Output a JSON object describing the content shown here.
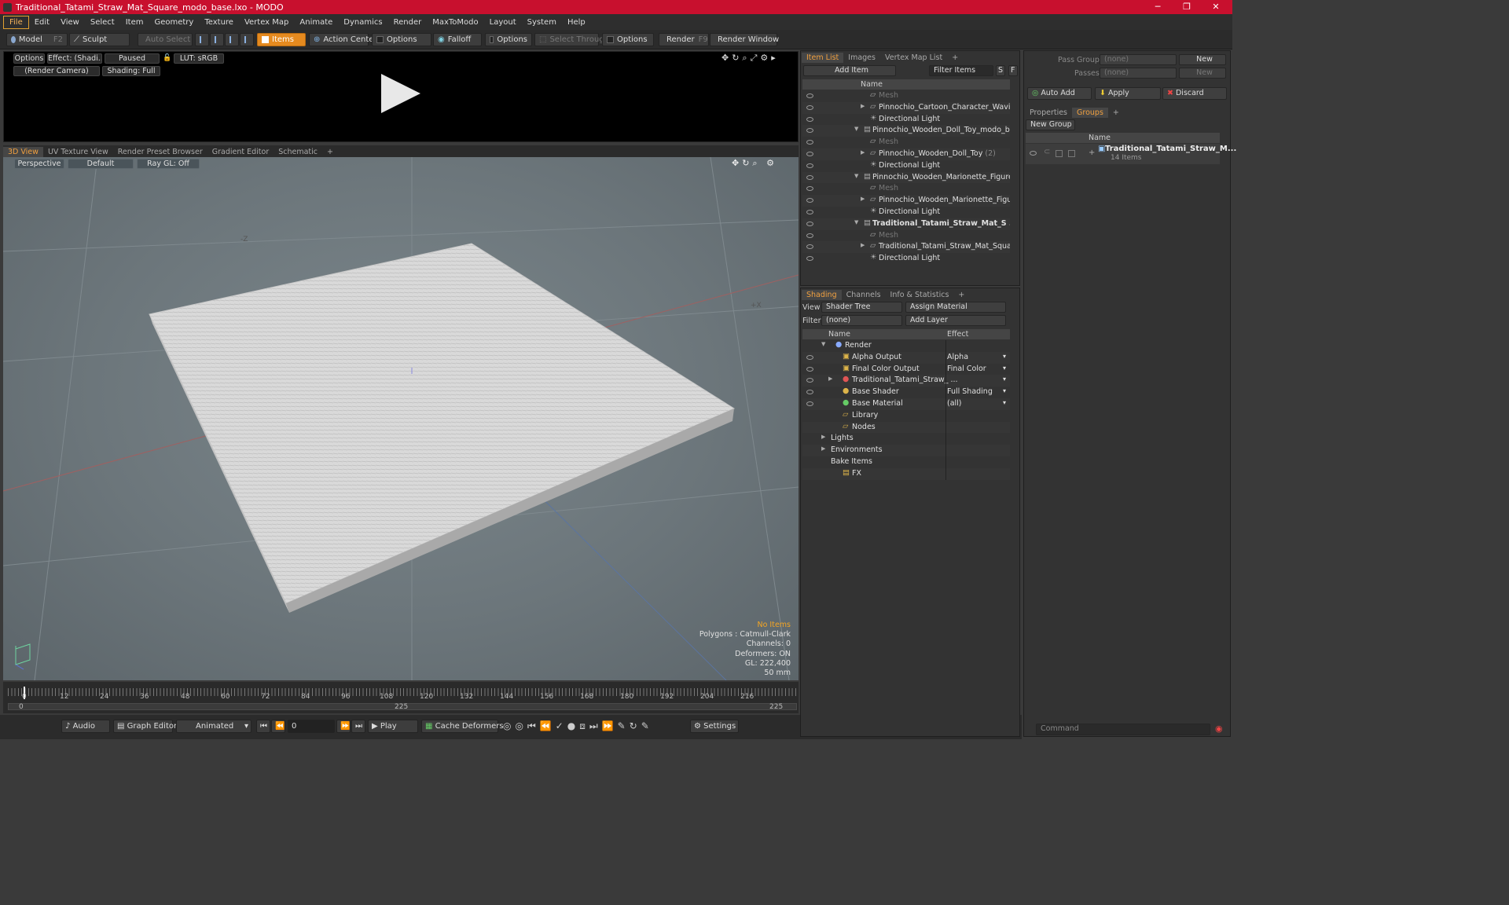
{
  "window": {
    "title": "Traditional_Tatami_Straw_Mat_Square_modo_base.lxo - MODO",
    "minimize": "─",
    "maximize": "❐",
    "close": "✕"
  },
  "menu": [
    "File",
    "Edit",
    "View",
    "Select",
    "Item",
    "Geometry",
    "Texture",
    "Vertex Map",
    "Animate",
    "Dynamics",
    "Render",
    "MaxToModo",
    "Layout",
    "System",
    "Help"
  ],
  "toolbar": {
    "model": "Model",
    "model_key": "F2",
    "sculpt": "Sculpt",
    "auto_select": "Auto Select",
    "items": "Items",
    "action_center": "Action Center",
    "options1": "Options",
    "falloff": "Falloff",
    "options2": "Options",
    "select_through": "Select Through",
    "options3": "Options",
    "render": "Render",
    "render_key": "F9",
    "render_window": "Render Window"
  },
  "render_view": {
    "options": "Options",
    "effect": "Effect: (Shadi...",
    "status": "Paused",
    "lut": "LUT: sRGB",
    "camera": "(Render Camera)",
    "shading": "Shading: Full"
  },
  "view_tabs": [
    "3D View",
    "UV Texture View",
    "Render Preset Browser",
    "Gradient Editor",
    "Schematic",
    "+"
  ],
  "viewport": {
    "perspective": "Perspective",
    "default": "Default",
    "raygl": "Ray GL: Off",
    "axis_z": "-Z",
    "axis_x": "+X",
    "info": {
      "no_items": "No Items",
      "polygons": "Polygons : Catmull-Clark",
      "channels": "Channels: 0",
      "deformers": "Deformers: ON",
      "gl": "GL: 222,400",
      "unit": "50 mm"
    }
  },
  "timeline": {
    "ticks": [
      "0",
      "12",
      "24",
      "36",
      "48",
      "60",
      "72",
      "84",
      "96",
      "108",
      "120",
      "132",
      "144",
      "156",
      "168",
      "180",
      "192",
      "204",
      "216"
    ],
    "start": "0",
    "mid": "225",
    "end": "225"
  },
  "bottombar": {
    "audio": "Audio",
    "graph_editor": "Graph Editor",
    "animated": "Animated",
    "frame": "0",
    "play": "Play",
    "cache": "Cache Deformers",
    "settings": "Settings"
  },
  "item_list": {
    "tabs": [
      "Item List",
      "Images",
      "Vertex Map List",
      "+"
    ],
    "add_item": "Add Item",
    "filter": "Filter Items",
    "s": "S",
    "f": "F",
    "col_name": "Name",
    "rows": [
      {
        "label": "Mesh",
        "dim": true,
        "indent": 2
      },
      {
        "label": "Pinnochio_Cartoon_Character_Wavin ...",
        "indent": 2,
        "arrow": "▶"
      },
      {
        "label": "Directional Light",
        "indent": 2
      },
      {
        "label": "Pinnochio_Wooden_Doll_Toy_modo_bas ...",
        "indent": 1,
        "arrow": "▼"
      },
      {
        "label": "Mesh",
        "dim": true,
        "indent": 2
      },
      {
        "label": "Pinnochio_Wooden_Doll_Toy",
        "suffix": "(2)",
        "indent": 2,
        "arrow": "▶"
      },
      {
        "label": "Directional Light",
        "indent": 2
      },
      {
        "label": "Pinnochio_Wooden_Marionette_Figure_ ...",
        "indent": 1,
        "arrow": "▼"
      },
      {
        "label": "Mesh",
        "dim": true,
        "indent": 2
      },
      {
        "label": "Pinnochio_Wooden_Marionette_Figur ...",
        "indent": 2,
        "arrow": "▶"
      },
      {
        "label": "Directional Light",
        "indent": 2
      },
      {
        "label": "Traditional_Tatami_Straw_Mat_S ...",
        "indent": 1,
        "arrow": "▼",
        "bold": true
      },
      {
        "label": "Mesh",
        "dim": true,
        "indent": 2
      },
      {
        "label": "Traditional_Tatami_Straw_Mat_Squar ...",
        "indent": 2,
        "arrow": "▶"
      },
      {
        "label": "Directional Light",
        "indent": 2
      }
    ]
  },
  "shading": {
    "tabs": [
      "Shading",
      "Channels",
      "Info & Statistics",
      "+"
    ],
    "view_label": "View",
    "view_value": "Shader Tree",
    "assign": "Assign Material",
    "filter_label": "Filter",
    "filter_value": "(none)",
    "add_layer": "Add Layer",
    "col_name": "Name",
    "col_effect": "Effect",
    "rows": [
      {
        "label": "Render",
        "effect": "",
        "arrow": "▼",
        "indent": 0
      },
      {
        "label": "Alpha Output",
        "effect": "Alpha",
        "indent": 1
      },
      {
        "label": "Final Color Output",
        "effect": "Final Color",
        "indent": 1
      },
      {
        "label": "Traditional_Tatami_Straw_ ...",
        "effect": "",
        "indent": 1,
        "arrow": "▶"
      },
      {
        "label": "Base Shader",
        "effect": "Full Shading",
        "indent": 1
      },
      {
        "label": "Base Material",
        "effect": "(all)",
        "indent": 1
      },
      {
        "label": "Library",
        "effect": "",
        "indent": 1
      },
      {
        "label": "Nodes",
        "effect": "",
        "indent": 1
      },
      {
        "label": "Lights",
        "effect": "",
        "indent": 0,
        "arrow": "▶"
      },
      {
        "label": "Environments",
        "effect": "",
        "indent": 0,
        "arrow": "▶"
      },
      {
        "label": "Bake Items",
        "effect": "",
        "indent": 0
      },
      {
        "label": "FX",
        "effect": "",
        "indent": 1
      }
    ]
  },
  "right": {
    "pass_groups": "Pass Groups",
    "pass_value": "(none)",
    "new1": "New",
    "passes": "Passes",
    "passes_value": "(none)",
    "new2": "New",
    "auto_add": "Auto Add",
    "apply": "Apply",
    "discard": "Discard",
    "tabs": [
      "Properties",
      "Groups",
      "+"
    ],
    "new_group": "New Group",
    "col_name": "Name",
    "group_name": "Traditional_Tatami_Straw_M...",
    "group_count": "14 Items",
    "command": "Command"
  }
}
